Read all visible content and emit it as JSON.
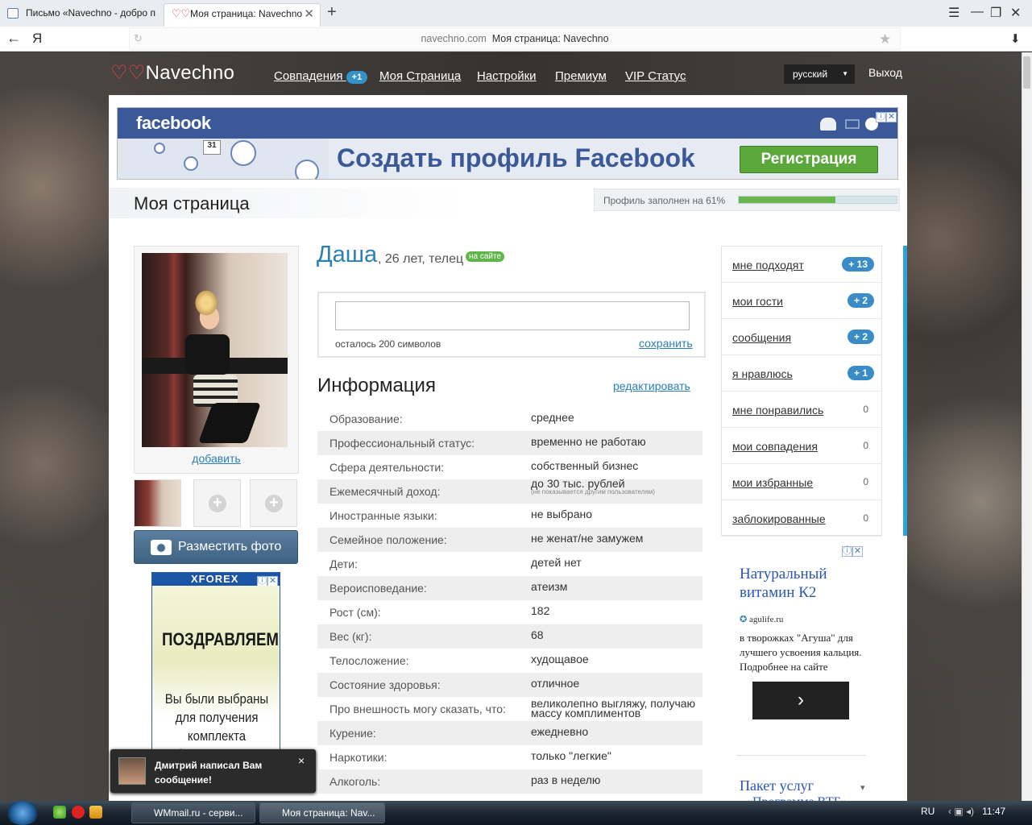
{
  "browser": {
    "tabs": [
      {
        "title": "Письмо «Navechno - добро п"
      },
      {
        "title": "Моя страница: Navechno",
        "active": true
      }
    ],
    "back_glyph": "←",
    "yandex_glyph": "Я",
    "new_tab": "+",
    "refresh_glyph": "↻",
    "star_glyph": "★",
    "download_glyph": "⬇",
    "menu_glyph": "☰",
    "minimize_glyph": "—",
    "restore_glyph": "❐",
    "close_glyph": "✕",
    "tab_close_glyph": "✕",
    "address_domain": "navechno.com",
    "address_title": "Моя страница: Navechno"
  },
  "site": {
    "logo_heart": "♡♡",
    "logo": "Navechno",
    "nav": [
      {
        "label": "Совпадения",
        "badge": "+1"
      },
      {
        "label": "Моя Страница"
      },
      {
        "label": "Настройки"
      },
      {
        "label": "Премиум"
      },
      {
        "label": "VIP Статус"
      }
    ],
    "language": "русский",
    "lang_caret": "▼",
    "logout": "Выход"
  },
  "fb_ad": {
    "logo": "facebook",
    "headline": "Создать профиль Facebook",
    "button": "Регистрация",
    "calendar": "31",
    "info_glyph": "ⓘ",
    "close_glyph": "✕"
  },
  "page": {
    "title": "Моя страница",
    "profile_fill_text": "Профиль заполнен на 61%",
    "profile_fill": 0.61
  },
  "photos": {
    "add_link": "добавить",
    "plus_glyph": "+",
    "upload_button": "Разместить фото"
  },
  "forex_ad": {
    "brand": "XFOREX",
    "congrats": "ПОЗДРАВЛЯЕМ!",
    "body": "Вы были выбраны для получения комплекта обучения Форекс"
  },
  "notification": {
    "text": "Дмитрий написал Вам сообщение!",
    "close": "×"
  },
  "profile": {
    "name": "Даша",
    "meta": ", 26 лет, телец",
    "online_badge": "на сайте",
    "chars_left": "осталось 200 символов",
    "save": "сохранить",
    "info_title": "Информация",
    "edit": "редактировать",
    "info": [
      {
        "label": "Образование:",
        "value": "среднее"
      },
      {
        "label": "Профессиональный статус:",
        "value": "временно не работаю"
      },
      {
        "label": "Сфера деятельности:",
        "value": "собственный бизнес"
      },
      {
        "label": "Ежемесячный доход:",
        "value": "до 30 тыс. рублей",
        "note": "(не показывается другим пользователям)"
      },
      {
        "label": "Иностранные языки:",
        "value": "не выбрано"
      },
      {
        "label": "Семейное положение:",
        "value": "не женат/не замужем"
      },
      {
        "label": "Дети:",
        "value": "детей нет"
      },
      {
        "label": "Вероисповедание:",
        "value": "атеизм"
      },
      {
        "label": "Рост (см):",
        "value": "182"
      },
      {
        "label": "Вес (кг):",
        "value": "68"
      },
      {
        "label": "Телосложение:",
        "value": "худощавое"
      },
      {
        "label": "Состояние здоровья:",
        "value": "отличное"
      },
      {
        "label": "Про внешность могу сказать, что:",
        "value": "великолепно выгляжу, получаю массу комплиментов"
      },
      {
        "label": "Курение:",
        "value": "ежедневно"
      },
      {
        "label": "Наркотики:",
        "value": "только \"легкие\""
      },
      {
        "label": "Алкоголь:",
        "value": "раз в неделю"
      }
    ]
  },
  "sidebar": [
    {
      "label": "мне подходят",
      "count": "+ 13"
    },
    {
      "label": "мои гости",
      "count": "+ 2"
    },
    {
      "label": "сообщения",
      "count": "+ 2"
    },
    {
      "label": "я нравлюсь",
      "count": "+ 1"
    },
    {
      "label": "мне понравились",
      "zero": "0"
    },
    {
      "label": "мои совпадения",
      "zero": "0"
    },
    {
      "label": "мои избранные",
      "zero": "0"
    },
    {
      "label": "заблокированные",
      "zero": "0"
    }
  ],
  "right_ad": {
    "title": "Натуральный витамин К2",
    "source": "agulife.ru",
    "body": "в творожках \"Агуша\" для лучшего усвоения кальция. Подробнее на сайте",
    "arrow": "›"
  },
  "right_ad2": {
    "title": "Пакет услуг",
    "subtitle": "«Программа ВТБ»",
    "caret": "▾"
  },
  "taskbar": {
    "items": [
      "WMmail.ru - серви...",
      "Моя страница: Nav..."
    ],
    "lang": "RU",
    "tray_icons": "‹ ▣ ◂)",
    "time": "11:47"
  },
  "colors": {
    "accent": "#2a7fb5",
    "fb": "#3b5998",
    "green": "#6ab54c",
    "badge": "#3a8cc6"
  }
}
